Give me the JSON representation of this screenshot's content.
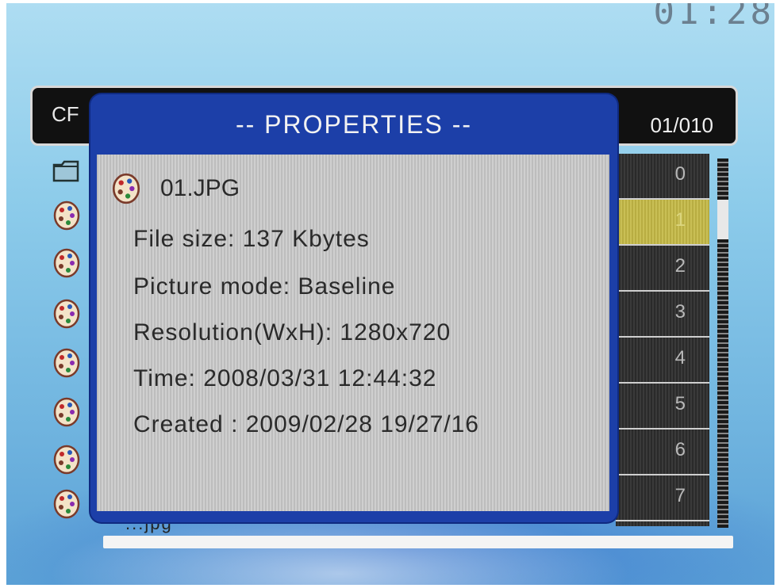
{
  "clock": "01:28",
  "top_bar": {
    "device_label": "CF",
    "page_counter": "01/010"
  },
  "dialog": {
    "title": "-- PROPERTIES --",
    "file_name": "01.JPG",
    "lines": [
      "File size: 137 Kbytes",
      "Picture mode: Baseline",
      "Resolution(WxH): 1280x720",
      "Time: 2008/03/31 12:44:32",
      "Created : 2009/02/28 19/27/16"
    ]
  },
  "thumbnails": {
    "numbers": [
      "0",
      "1",
      "2",
      "3",
      "4",
      "5",
      "6",
      "7"
    ],
    "selected_index": 1
  },
  "hidden_row_text": "...jpg",
  "icons": {
    "folder": "folder-icon",
    "image": "palette-image-icon"
  }
}
